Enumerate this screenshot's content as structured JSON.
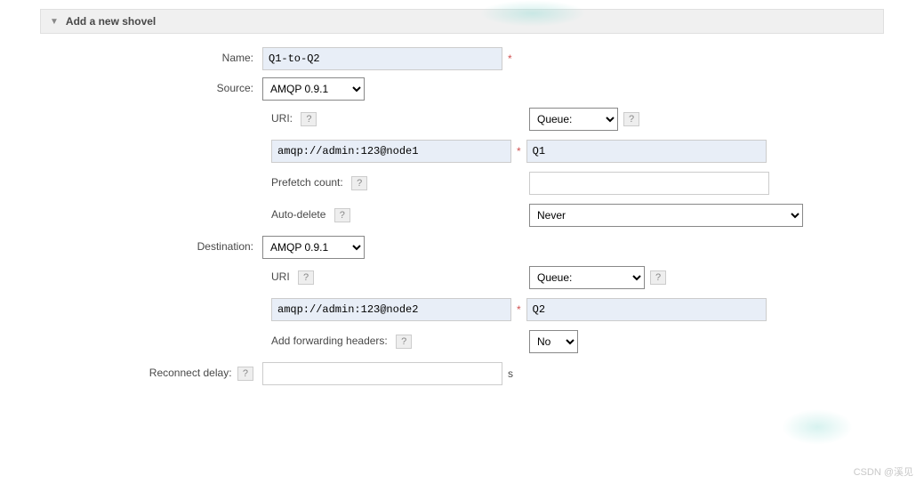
{
  "section": {
    "title": "Add a new shovel"
  },
  "name": {
    "label": "Name:",
    "value": "Q1-to-Q2"
  },
  "source": {
    "label": "Source:",
    "protocol": "AMQP 0.9.1",
    "uri_label": "URI:",
    "uri_value": "amqp://admin:123@node1",
    "target_type": "Queue:",
    "target_value": "Q1",
    "prefetch_label": "Prefetch count:",
    "prefetch_value": "",
    "autodelete_label": "Auto-delete",
    "autodelete_value": "Never"
  },
  "destination": {
    "label": "Destination:",
    "protocol": "AMQP 0.9.1",
    "uri_label": "URI",
    "uri_value": "amqp://admin:123@node2",
    "target_type": "Queue:",
    "target_value": "Q2",
    "fwd_label": "Add forwarding headers:",
    "fwd_value": "No"
  },
  "reconnect": {
    "label": "Reconnect delay:",
    "value": "",
    "unit": "s"
  },
  "help_char": "?",
  "required_char": "*",
  "watermark": "CSDN @溪见"
}
